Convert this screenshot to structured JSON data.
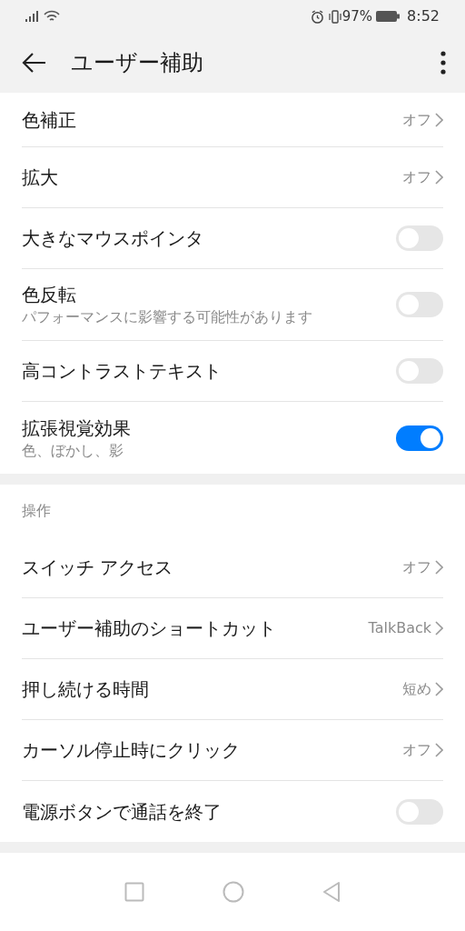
{
  "status_bar": {
    "battery": "97%",
    "time": "8:52"
  },
  "app_bar": {
    "title": "ユーザー補助"
  },
  "sections": [
    {
      "items": [
        {
          "kind": "link",
          "title": "色補正",
          "value": "オフ"
        },
        {
          "kind": "link",
          "title": "拡大",
          "value": "オフ"
        },
        {
          "kind": "toggle",
          "title": "大きなマウスポインタ",
          "on": false
        },
        {
          "kind": "toggle",
          "title": "色反転",
          "subtitle": "パフォーマンスに影響する可能性があります",
          "on": false
        },
        {
          "kind": "toggle",
          "title": "高コントラストテキスト",
          "on": false
        },
        {
          "kind": "toggle",
          "title": "拡張視覚効果",
          "subtitle": "色、ぼかし、影",
          "on": true
        }
      ]
    },
    {
      "header": "操作",
      "items": [
        {
          "kind": "link",
          "title": "スイッチ アクセス",
          "value": "オフ"
        },
        {
          "kind": "link",
          "title": "ユーザー補助のショートカット",
          "value": "TalkBack"
        },
        {
          "kind": "link",
          "title": "押し続ける時間",
          "value": "短め"
        },
        {
          "kind": "link",
          "title": "カーソル停止時にクリック",
          "value": "オフ"
        },
        {
          "kind": "toggle",
          "title": "電源ボタンで通話を終了",
          "on": false
        }
      ]
    }
  ]
}
